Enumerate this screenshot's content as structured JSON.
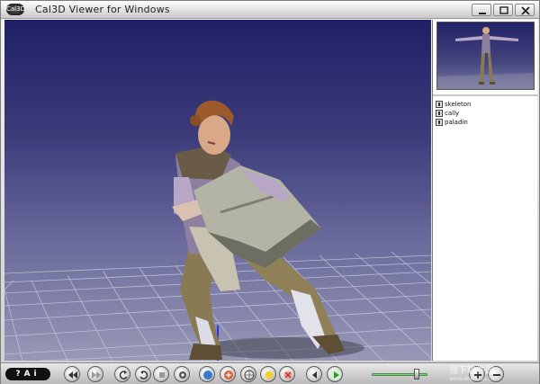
{
  "window": {
    "title": "Cal3D Viewer for Windows",
    "app_icon_text": "Cal3D",
    "controls": [
      "minimize-icon",
      "maximize-icon",
      "close-icon"
    ]
  },
  "side_panel": {
    "models": [
      {
        "label": "skeleton",
        "icon": "model-icon"
      },
      {
        "label": "cally",
        "icon": "model-icon"
      },
      {
        "label": "paladin",
        "icon": "model-icon"
      }
    ]
  },
  "toolbar": {
    "logo": "?Ai",
    "buttons": [
      {
        "name": "rewind-button",
        "icon": "rewind-icon"
      },
      {
        "name": "fast-forward-button",
        "icon": "fast-forward-icon"
      },
      {
        "name": "rotate-left-button",
        "icon": "rotate-left-icon"
      },
      {
        "name": "rotate-right-button",
        "icon": "rotate-right-icon"
      },
      {
        "name": "stop-button",
        "icon": "stop-icon"
      },
      {
        "name": "view-mode-button",
        "icon": "eye-icon"
      },
      {
        "name": "skeleton-button",
        "icon": "skeleton-icon"
      },
      {
        "name": "texture-button",
        "icon": "texture-icon"
      },
      {
        "name": "wireframe-button",
        "icon": "wireframe-icon"
      },
      {
        "name": "light-button",
        "icon": "light-icon"
      },
      {
        "name": "disable-button",
        "icon": "disable-icon"
      },
      {
        "name": "previous-button",
        "icon": "previous-icon"
      },
      {
        "name": "play-button",
        "icon": "play-icon"
      },
      {
        "name": "zoom-in-button",
        "icon": "plus-icon"
      },
      {
        "name": "zoom-out-button",
        "icon": "minus-icon"
      }
    ],
    "speed_level": 0.8
  },
  "watermark": {
    "text": "当下软件园",
    "url": "www.downxia.com"
  },
  "colors": {
    "viewport_top": "#1f1f66",
    "viewport_bottom": "#9898b6",
    "play_green": "#2e9b2e",
    "slider_green": "#7ad27a"
  }
}
